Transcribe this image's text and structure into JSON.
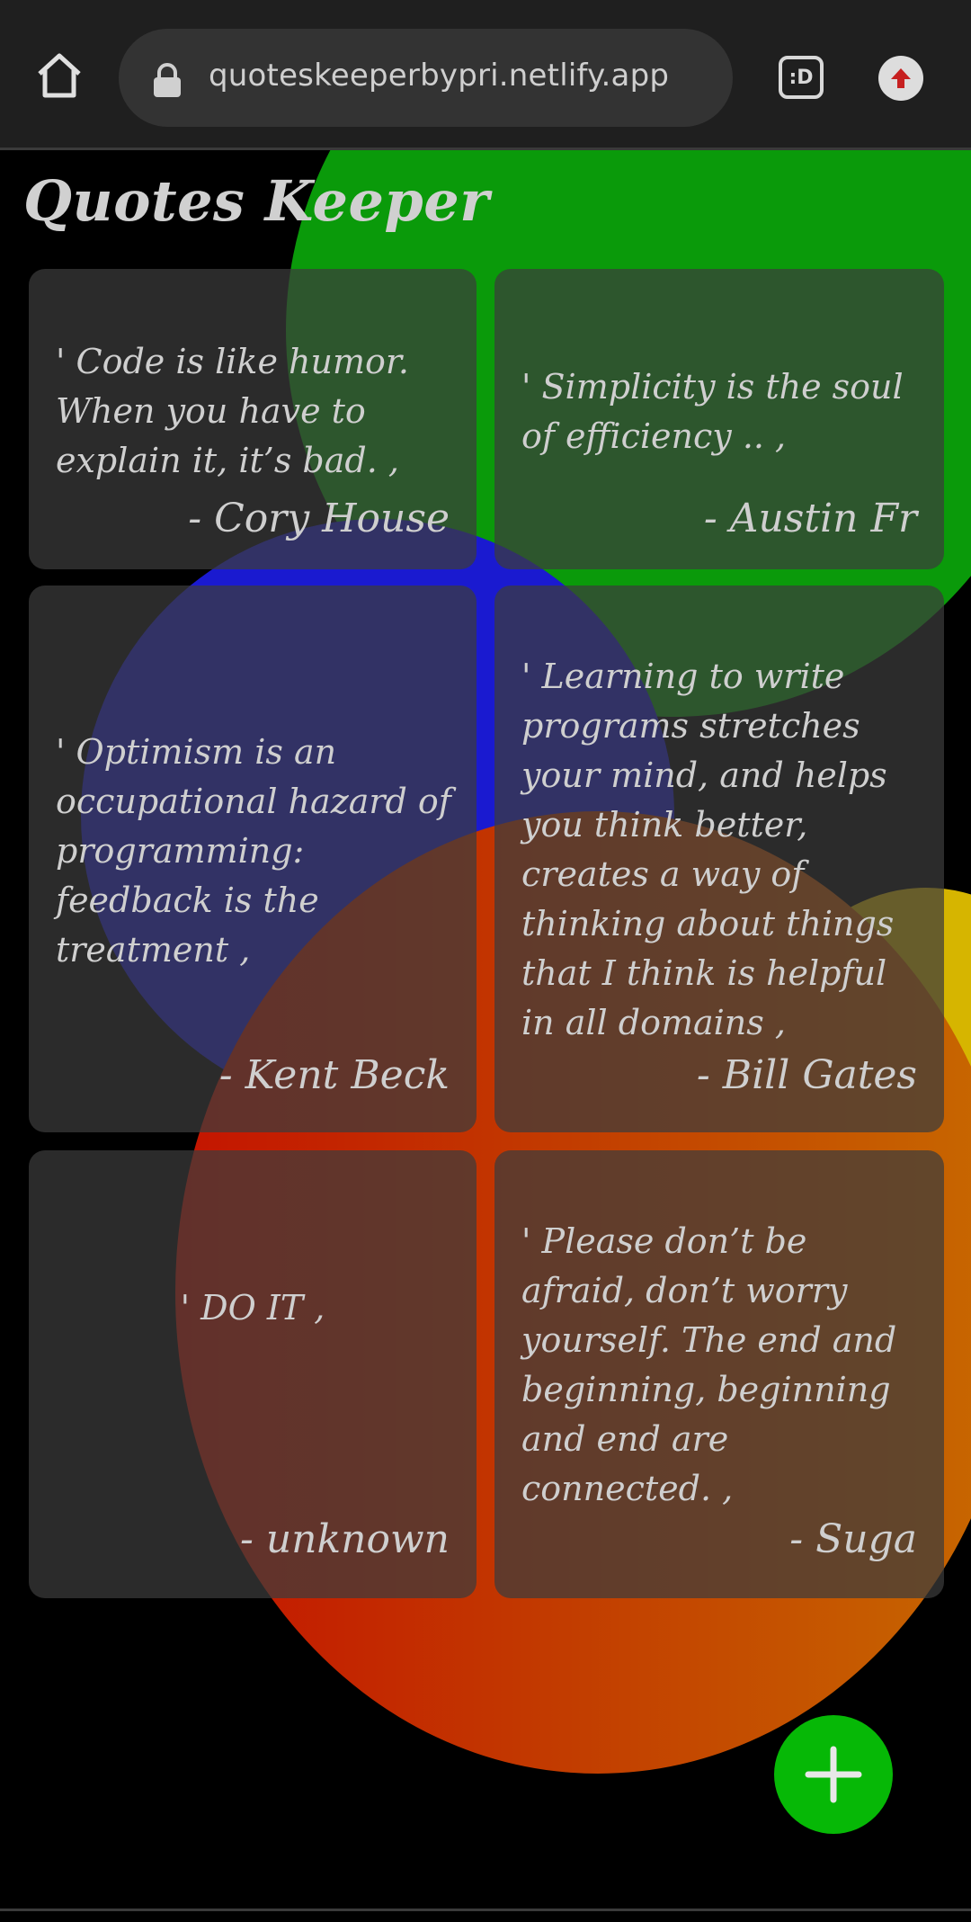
{
  "browser": {
    "url": "quoteskeeperbypri.netlify.app",
    "tab_switcher_label": ":D"
  },
  "app": {
    "title": "Quotes Keeper"
  },
  "quotes": [
    {
      "text": "' Code is like humor. When you have to explain it, it’s bad. ,",
      "author": "- Cory House"
    },
    {
      "text": "' Simplicity is the soul of efficiency .. ,",
      "author": "- Austin Fr"
    },
    {
      "text": "' Optimism is an occupational hazard of programming: feedback is the treatment ,",
      "author": "- Kent Beck"
    },
    {
      "text": "' Learning to write programs stretches your mind, and helps you think better, creates a way of thinking about things that I think is helpful in all domains ,",
      "author": "- Bill Gates"
    },
    {
      "text": "' DO IT ,",
      "author": "- unknown"
    },
    {
      "text": "' Please don’t be afraid, don’t worry yourself. The end and beginning, beginning and end are connected. ,",
      "author": "- Suga"
    }
  ],
  "fab": {
    "icon": "plus-icon"
  },
  "colors": {
    "background": "#000000",
    "card": "#3c3c3c",
    "accent_green": "#06b806",
    "blob_green": "#0a9a0a",
    "blob_blue": "#1a1ad0",
    "blob_yellow": "#d6b500",
    "blob_orange": "#c23b00"
  }
}
